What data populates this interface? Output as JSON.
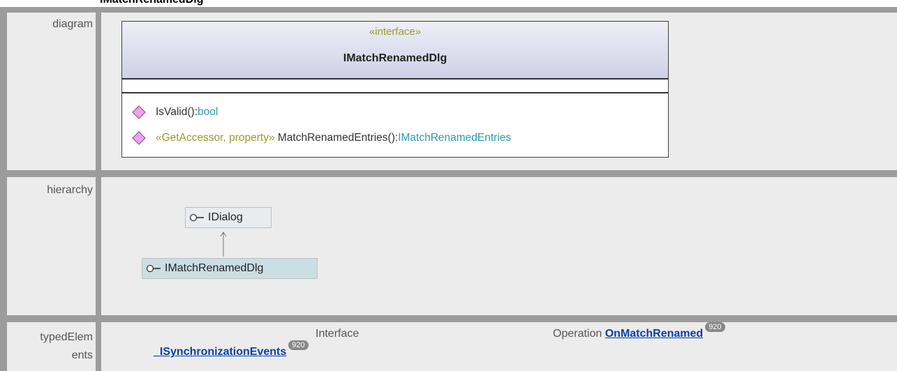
{
  "page_title": "IMatchRenamedDlg",
  "rows": {
    "diagram": {
      "label": "diagram"
    },
    "hierarchy": {
      "label": "hierarchy"
    },
    "typed": {
      "label_line1": "typedElem",
      "label_line2": "ents"
    }
  },
  "uml": {
    "stereotype": "«interface»",
    "name": "IMatchRenamedDlg",
    "operations": [
      {
        "stereotype": "",
        "signature": "IsValid():",
        "return_type": "bool"
      },
      {
        "stereotype": "«GetAccessor, property»",
        "signature": " MatchRenamedEntries():",
        "return_type": "IMatchRenamedEntries"
      }
    ]
  },
  "hierarchy": {
    "parent": "IDialog",
    "child": "IMatchRenamedDlg"
  },
  "typed_elements": {
    "interface_label": "Interface",
    "interface_link": "_ISynchronizationEvents",
    "interface_badge": "920",
    "operation_label": "Operation",
    "operation_link": "OnMatchRenamed",
    "operation_badge": "920"
  },
  "colors": {
    "row_bg": "#ececec",
    "border": "#9c9c9c",
    "stereotype": "#9b9b2a",
    "type": "#2a9bb0",
    "link": "#0a3fa8"
  }
}
